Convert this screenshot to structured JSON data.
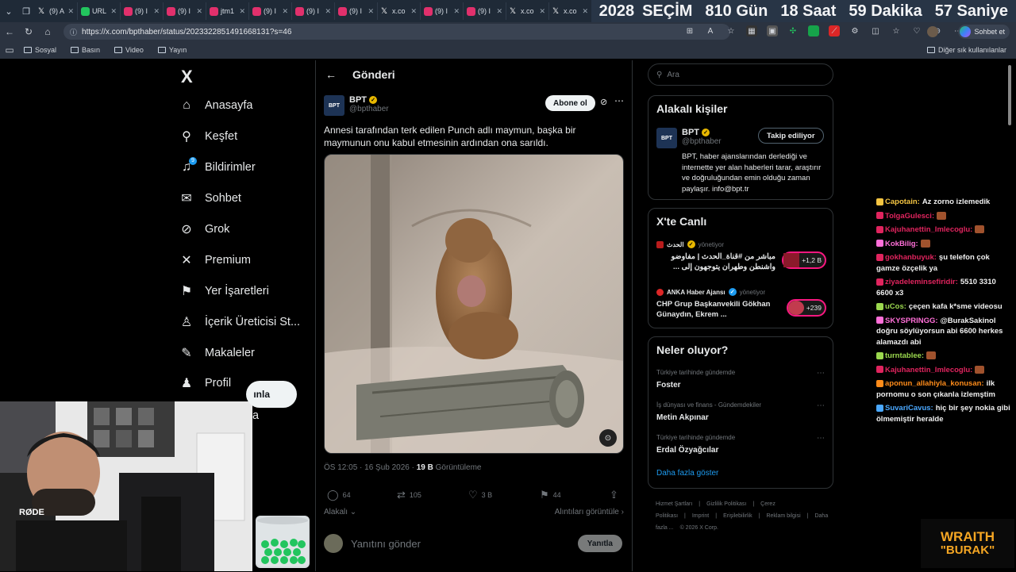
{
  "browser": {
    "tabs": [
      {
        "label": "(9) A",
        "icon": "x-icon",
        "color": "#ffffff"
      },
      {
        "label": "URL",
        "icon": "url-icon",
        "color": "#22c55e"
      },
      {
        "label": "(9) I",
        "icon": "instagram-icon",
        "color": "#e1306c"
      },
      {
        "label": "(9) I",
        "icon": "instagram-icon",
        "color": "#e1306c"
      },
      {
        "label": "jtm1",
        "icon": "instagram-icon",
        "color": "#e1306c"
      },
      {
        "label": "(9) I",
        "icon": "instagram-icon",
        "color": "#e1306c"
      },
      {
        "label": "(9) I",
        "icon": "instagram-icon",
        "color": "#e1306c"
      },
      {
        "label": "(9) I",
        "icon": "instagram-icon",
        "color": "#e1306c"
      },
      {
        "label": "x.co",
        "icon": "x-icon",
        "color": "#ffffff"
      },
      {
        "label": "(9) I",
        "icon": "instagram-icon",
        "color": "#e1306c"
      },
      {
        "label": "(9) I",
        "icon": "instagram-icon",
        "color": "#e1306c"
      },
      {
        "label": "x.co",
        "icon": "x-icon",
        "color": "#ffffff"
      },
      {
        "label": "x.co",
        "icon": "x-icon",
        "color": "#ffffff"
      },
      {
        "label": "x.co",
        "icon": "x-icon",
        "color": "#ffffff"
      }
    ],
    "url": "https://x.com/bpthaber/status/2023322851491668131?s=46",
    "profile_label": "Sohbet et",
    "bookmarks": [
      "Sosyal",
      "Basın",
      "Video",
      "Yayın"
    ],
    "bookmarks_right": "Diğer sık kullanılanlar"
  },
  "countdown": {
    "year": "2028",
    "label": "SEÇİM",
    "days": "810 Gün",
    "hours": "18 Saat",
    "minutes": "59 Dakika",
    "seconds": "57 Saniye"
  },
  "sidebar": {
    "logo": "X",
    "items": [
      {
        "label": "Anasayfa",
        "icon": "home-icon",
        "glyph": "⌂"
      },
      {
        "label": "Keşfet",
        "icon": "search-icon",
        "glyph": "⚲"
      },
      {
        "label": "Bildirimler",
        "icon": "bell-icon",
        "glyph": "♫"
      },
      {
        "label": "Sohbet",
        "icon": "mail-icon",
        "glyph": "✉"
      },
      {
        "label": "Grok",
        "icon": "grok-icon",
        "glyph": "⊘"
      },
      {
        "label": "Premium",
        "icon": "x-premium-icon",
        "glyph": "✕"
      },
      {
        "label": "Yer İşaretleri",
        "icon": "bookmark-icon",
        "glyph": "⚑"
      },
      {
        "label": "İçerik Üreticisi St...",
        "icon": "creator-icon",
        "glyph": "♙"
      },
      {
        "label": "Makaleler",
        "icon": "article-icon",
        "glyph": "✎"
      },
      {
        "label": "Profil",
        "icon": "profile-icon",
        "glyph": "♟"
      }
    ],
    "notif_badge": "9",
    "partial_item": "a",
    "post_button": "ınla"
  },
  "post": {
    "header_title": "Gönderi",
    "author_name": "BPT",
    "author_handle": "@bpthaber",
    "avatar_text": "BPT",
    "follow_label": "Abone ol",
    "text": "Annesi tarafından terk edilen Punch adlı maymun, başka bir maymunun onu kabul etmesinin ardından ona sarıldı.",
    "time": "ÖS 12:05 · 16 Şub 2026 · ",
    "views": "19 B",
    "views_label": " Görüntüleme",
    "replies": "64",
    "reposts": "105",
    "likes": "3 B",
    "bookmarks": "44",
    "related_label": "Alakalı",
    "quotes_label": "Alıntıları görüntüle",
    "reply_placeholder": "Yanıtını gönder",
    "reply_button": "Yanıtla"
  },
  "right": {
    "search_placeholder": "Ara",
    "relevant_title": "Alakalı kişiler",
    "relevant_name": "BPT",
    "relevant_handle": "@bpthaber",
    "relevant_follow": "Takip ediliyor",
    "relevant_bio": "BPT, haber ajanslarından derlediği ve internette yer alan haberleri tarar, araştırır ve doğruluğundan emin olduğu zaman paylaşır. info@bpt.tr",
    "live_title": "X'te Canlı",
    "live": [
      {
        "host": "الحدث",
        "role": "yönetiyor",
        "text": "مباشر من #قناة_الحدث | مفاوضو واشنطن وطهران يتوجهون إلى ...",
        "count": "+1,2 B"
      },
      {
        "host": "ANKA Haber Ajansı",
        "role": "yönetiyor",
        "text": "CHP Grup Başkanvekili Gökhan Günaydın, Ekrem ...",
        "count": "+239"
      }
    ],
    "trends_title": "Neler oluyor?",
    "trends": [
      {
        "category": "Türkiye tarihinde gündemde",
        "title": "Foster"
      },
      {
        "category": "İş dünyası ve finans - Gündemdekiler",
        "title": "Metin Akpınar"
      },
      {
        "category": "Türkiye tarihinde gündemde",
        "title": "Erdal Özyağcılar"
      }
    ],
    "show_more": "Daha fazla göster",
    "footer": [
      "Hizmet Şartları",
      "|",
      "Gizlilik Politikası",
      "|",
      "Çerez Politikası",
      "|",
      "Imprint",
      "|",
      "Erişilebilirlik",
      "|",
      "Reklam bilgisi",
      "|",
      "Daha fazla ...",
      "© 2026 X Corp."
    ]
  },
  "chat": [
    {
      "user": "Capotain:",
      "color": "#f5c542",
      "msg": "Az zorno izlemedik"
    },
    {
      "user": "TolgaGulesci:",
      "color": "#e0245e",
      "msg": ""
    },
    {
      "user": "Kajuhanettin_Imlecoglu:",
      "color": "#e0245e",
      "msg": ""
    },
    {
      "user": "KokBilig:",
      "color": "#ff6fd8",
      "msg": ""
    },
    {
      "user": "gokhanbuyuk:",
      "color": "#e0245e",
      "msg": "şu telefon çok gamze özçelik ya"
    },
    {
      "user": "ziyadeleminsefiridir:",
      "color": "#e0245e",
      "msg": "5510 3310 6600 x3"
    },
    {
      "user": "uCos:",
      "color": "#9bd84e",
      "msg": "çeçen kafa k*sme videosu"
    },
    {
      "user": "SKYSPRINGG:",
      "color": "#ff6fd8",
      "msg": "@BurakSakinol doğru söylüyorsun abi 6600 herkes alamazdı abi"
    },
    {
      "user": "turntablee:",
      "color": "#9bd84e",
      "msg": ""
    },
    {
      "user": "Kajuhanettin_Imlecoglu:",
      "color": "#e0245e",
      "msg": ""
    },
    {
      "user": "aponun_allahiyla_konusan:",
      "color": "#ff8c1a",
      "msg": "ilk pornomu o son çıkanla izlemştim"
    },
    {
      "user": "SuvariCavus:",
      "color": "#4aa8ff",
      "msg": "hiç bir şey nokia gibi ölmemiştir heralde"
    }
  ],
  "overlay": {
    "brand_line1": "WRAITH",
    "brand_line2": "\"BURAK\"",
    "mic_label": "RØDE"
  },
  "colors": {
    "accent": "#1d9bf0",
    "like_live": "#f91880",
    "page_bg": "#000000"
  }
}
